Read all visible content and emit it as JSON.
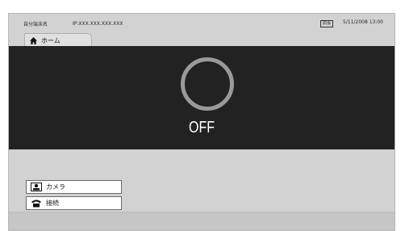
{
  "status_bar": {
    "terminal_name": "自分端末名",
    "ip": "IP:XXX.XXX.XXX.XXX",
    "badge": "拡張",
    "datetime": "5/11/2008  13:00"
  },
  "tabs": {
    "home_label": "ホーム"
  },
  "main": {
    "status_text": "OFF"
  },
  "menu": {
    "camera_label": "カメラ",
    "connect_label": "接続"
  },
  "icons": [
    "home-icon",
    "camera-icon",
    "phone-icon"
  ],
  "colors": {
    "main_bg": "#222222",
    "frame_bg": "#d2d2d2",
    "ring": "#9a9a9a"
  }
}
